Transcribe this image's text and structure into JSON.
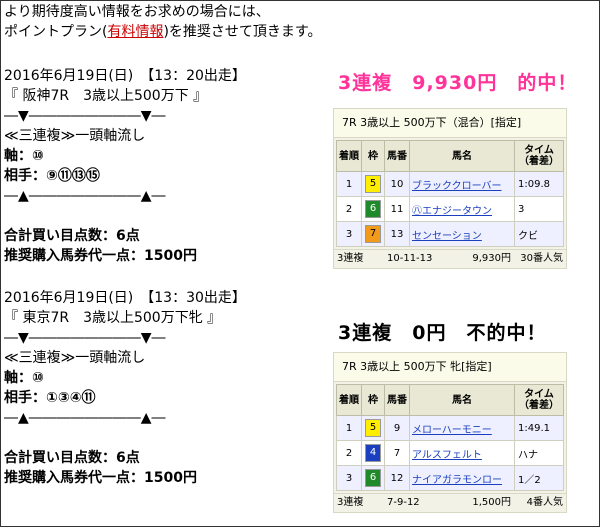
{
  "intro": {
    "line1": "より期待度高い情報をお求めの場合には、",
    "line2_pre": "ポイントプラン(",
    "line2_link": "有料情報",
    "line2_post": ")を推奨させて頂きます。"
  },
  "race1": {
    "date": "2016年6月19日(日)　【13：20出走】",
    "race": "『 阪神7R　3歳以上500万下 』",
    "divider": "―▼――――――――▼―",
    "bet_type": "≪三連複≫一頭軸流し",
    "axis": "軸：⑩",
    "partners": "相手：⑨⑪⑬⑮",
    "divider2": "―▲――――――――▲―",
    "total": "合計買い目点数：6点",
    "recommend": "推奨購入馬券代一点：1500円"
  },
  "race2": {
    "date": "2016年6月19日(日)　【13：30出走】",
    "race": "『 東京7R　3歳以上500万下牝 』",
    "divider": "―▼――――――――▼―",
    "bet_type": "≪三連複≫一頭軸流し",
    "axis": "軸：⑩",
    "partners": "相手：①③④⑪",
    "divider2": "―▲――――――――▲―",
    "total": "合計買い目点数：6点",
    "recommend": "推奨購入馬券代一点：1500円"
  },
  "result1": {
    "title": "3連複　9,930円　的中！",
    "header": "7R 3歳以上 500万下（混合）[指定]",
    "cols": [
      "着順",
      "枠",
      "馬番",
      "馬名",
      "タイム（着差）"
    ],
    "rows": [
      {
        "pos": "1",
        "frame": "5",
        "num": "10",
        "name": "ブラッククローバー",
        "time": "1:09.8"
      },
      {
        "pos": "2",
        "frame": "6",
        "num": "11",
        "name": "㊇エナジータウン",
        "time": "3"
      },
      {
        "pos": "3",
        "frame": "7",
        "num": "13",
        "name": "センセーション",
        "time": "クビ"
      }
    ],
    "payout_type": "3連複",
    "payout_combo": "10-11-13",
    "payout_amount": "9,930円",
    "payout_pop": "30番人気"
  },
  "result2": {
    "title": "3連複　0円　不的中！",
    "header": "7R 3歳以上 500万下 牝[指定]",
    "cols": [
      "着順",
      "枠",
      "馬番",
      "馬名",
      "タイム（着差）"
    ],
    "rows": [
      {
        "pos": "1",
        "frame": "5",
        "num": "9",
        "name": "メローハーモニー",
        "time": "1:49.1"
      },
      {
        "pos": "2",
        "frame": "4",
        "num": "7",
        "name": "アルスフェルト",
        "time": "ハナ"
      },
      {
        "pos": "3",
        "frame": "6",
        "num": "12",
        "name": "ナイアガラモンロー",
        "time": "1／2"
      }
    ],
    "payout_type": "3連複",
    "payout_combo": "7-9-12",
    "payout_amount": "1,500円",
    "payout_pop": "4番人気"
  }
}
